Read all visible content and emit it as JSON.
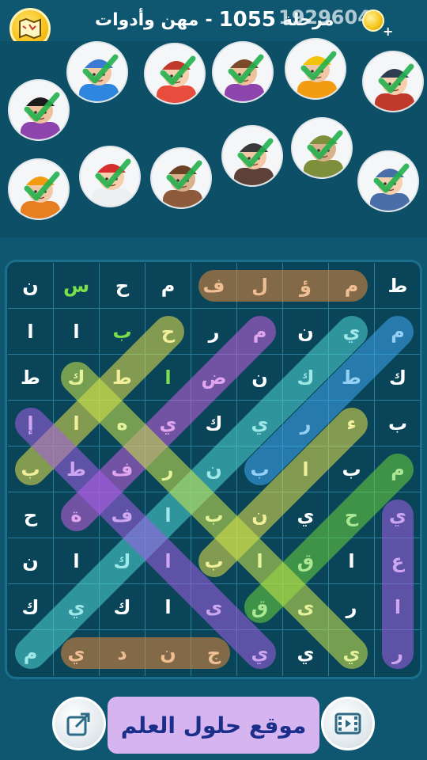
{
  "header": {
    "category": "مهن وأدوات",
    "dash": "-",
    "level": "1055",
    "level_word": "مرحلة",
    "coins": "1929604",
    "coin_plus": "+"
  },
  "clues": [
    {
      "name": "profession-1",
      "icon": "plumber-avatar-icon",
      "found": true
    },
    {
      "name": "profession-2",
      "icon": "chef-avatar-icon",
      "found": true
    },
    {
      "name": "profession-3",
      "icon": "singer-avatar-icon",
      "found": true
    },
    {
      "name": "profession-4",
      "icon": "electrician-avatar-icon",
      "found": true
    },
    {
      "name": "profession-5",
      "icon": "woodcutter-avatar-icon",
      "found": true
    },
    {
      "name": "profession-6",
      "icon": "writer-avatar-icon",
      "found": true
    },
    {
      "name": "profession-7",
      "icon": "builder-avatar-icon",
      "found": true
    },
    {
      "name": "profession-8",
      "icon": "firefighter-avatar-icon",
      "found": true
    },
    {
      "name": "profession-9",
      "icon": "shepherd-avatar-icon",
      "found": true
    },
    {
      "name": "profession-10",
      "icon": "detective-avatar-icon",
      "found": true
    },
    {
      "name": "profession-11",
      "icon": "soldier-avatar-icon",
      "found": true
    },
    {
      "name": "profession-12",
      "icon": "mechanic-avatar-icon",
      "found": true
    }
  ],
  "grid": {
    "rows": [
      [
        "ن",
        "س",
        "ح",
        "م",
        "ف",
        "ل",
        "ؤ",
        "م",
        "ط"
      ],
      [
        "ا",
        "ا",
        "ب",
        "ح",
        "ر",
        "م",
        "ن",
        "ي",
        "م"
      ],
      [
        "ط",
        "ك",
        "ط",
        "ا",
        "ض",
        "ن",
        "ك",
        "ط",
        "ك"
      ],
      [
        "إ",
        "ا",
        "ه",
        "ي",
        "ك",
        "ي",
        "ر",
        "ء",
        "ب"
      ],
      [
        "ب",
        "ط",
        "ف",
        "ر",
        "ن",
        "ب",
        "ا",
        "ب",
        "م"
      ],
      [
        "ح",
        "ة",
        "ف",
        "ا",
        "ب",
        "ن",
        "ي",
        "ح",
        "ي"
      ],
      [
        "ن",
        "ا",
        "ك",
        "ا",
        "ب",
        "ا",
        "ق",
        "ا",
        "ع"
      ],
      [
        "ك",
        "ي",
        "ك",
        "ا",
        "ى",
        "ق",
        "ى",
        "ر",
        "ا"
      ],
      [
        "م",
        "ي",
        "د",
        "ن",
        "ج",
        "ي",
        "ي",
        "ي",
        "ر"
      ]
    ],
    "green_letters": [
      "س",
      "ب",
      "ا"
    ]
  },
  "colors": {
    "orange": "#e58a3c",
    "yellow": "#e6e34a",
    "purple": "#c85ee0",
    "cyan": "#4fd6d6",
    "blue": "#3fa8f0",
    "green": "#6ad43c",
    "violet": "#a45ee6",
    "lime": "#cde84a"
  },
  "bottom": {
    "banner_text": "موقع حلول العلم"
  }
}
